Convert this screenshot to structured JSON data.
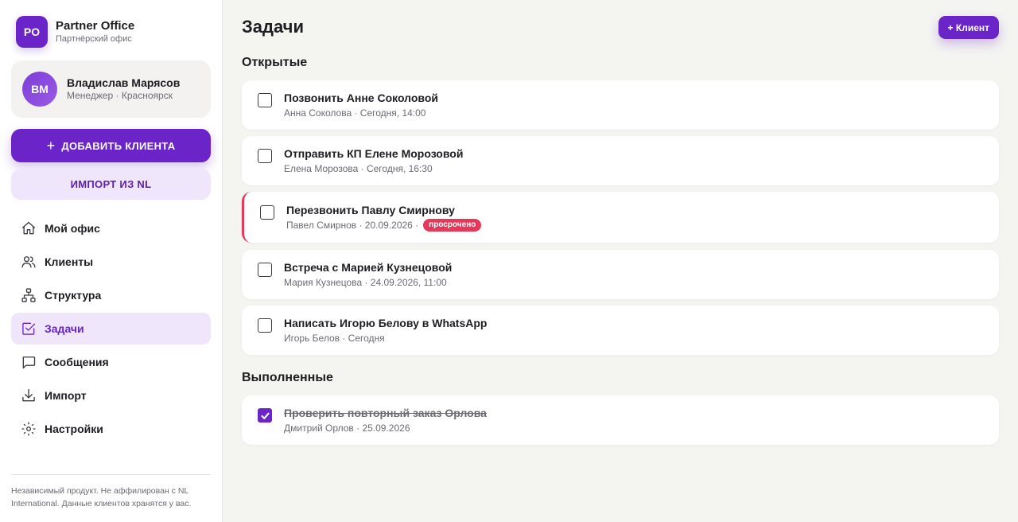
{
  "brand": {
    "logo": "PO",
    "name": "Partner Office",
    "subtitle": "Партнёрский офис"
  },
  "user": {
    "initials": "ВМ",
    "name": "Владислав Марясов",
    "role": "Менеджер · Красноярск"
  },
  "sidebar": {
    "add_client_label": "ДОБАВИТЬ КЛИЕНТА",
    "import_label": "ИМПОРТ ИЗ NL",
    "nav": [
      {
        "label": "Мой офис",
        "icon": "home-icon"
      },
      {
        "label": "Клиенты",
        "icon": "users-icon"
      },
      {
        "label": "Структура",
        "icon": "structure-icon"
      },
      {
        "label": "Задачи",
        "icon": "tasks-icon",
        "active": true
      },
      {
        "label": "Сообщения",
        "icon": "message-icon"
      },
      {
        "label": "Импорт",
        "icon": "download-icon"
      },
      {
        "label": "Настройки",
        "icon": "settings-icon"
      }
    ],
    "disclaimer": "Независимый продукт. Не аффилирован с NL International. Данные клиентов хранятся у вас."
  },
  "main": {
    "title": "Задачи",
    "add_client_button": "+ Клиент",
    "open_section": "Открытые",
    "done_section": "Выполненные",
    "open_tasks": [
      {
        "title": "Позвонить Анне Соколовой",
        "meta": "Анна Соколова · Сегодня, 14:00"
      },
      {
        "title": "Отправить КП Елене Морозовой",
        "meta": "Елена Морозова · Сегодня, 16:30"
      },
      {
        "title": "Перезвонить Павлу Смирнову",
        "meta": "Павел Смирнов · 20.09.2026 ·",
        "badge": "просрочено"
      },
      {
        "title": "Встреча с Марией Кузнецовой",
        "meta": "Мария Кузнецова · 24.09.2026, 11:00"
      },
      {
        "title": "Написать Игорю Белову в WhatsApp",
        "meta": "Игорь Белов · Сегодня"
      }
    ],
    "done_tasks": [
      {
        "title": "Проверить повторный заказ Орлова",
        "meta": "Дмитрий Орлов · 25.09.2026"
      }
    ]
  },
  "colors": {
    "accent": "#6a24c8",
    "accent_light": "#efe6fb",
    "overdue": "#e5395c",
    "background": "#f4f4f1"
  }
}
